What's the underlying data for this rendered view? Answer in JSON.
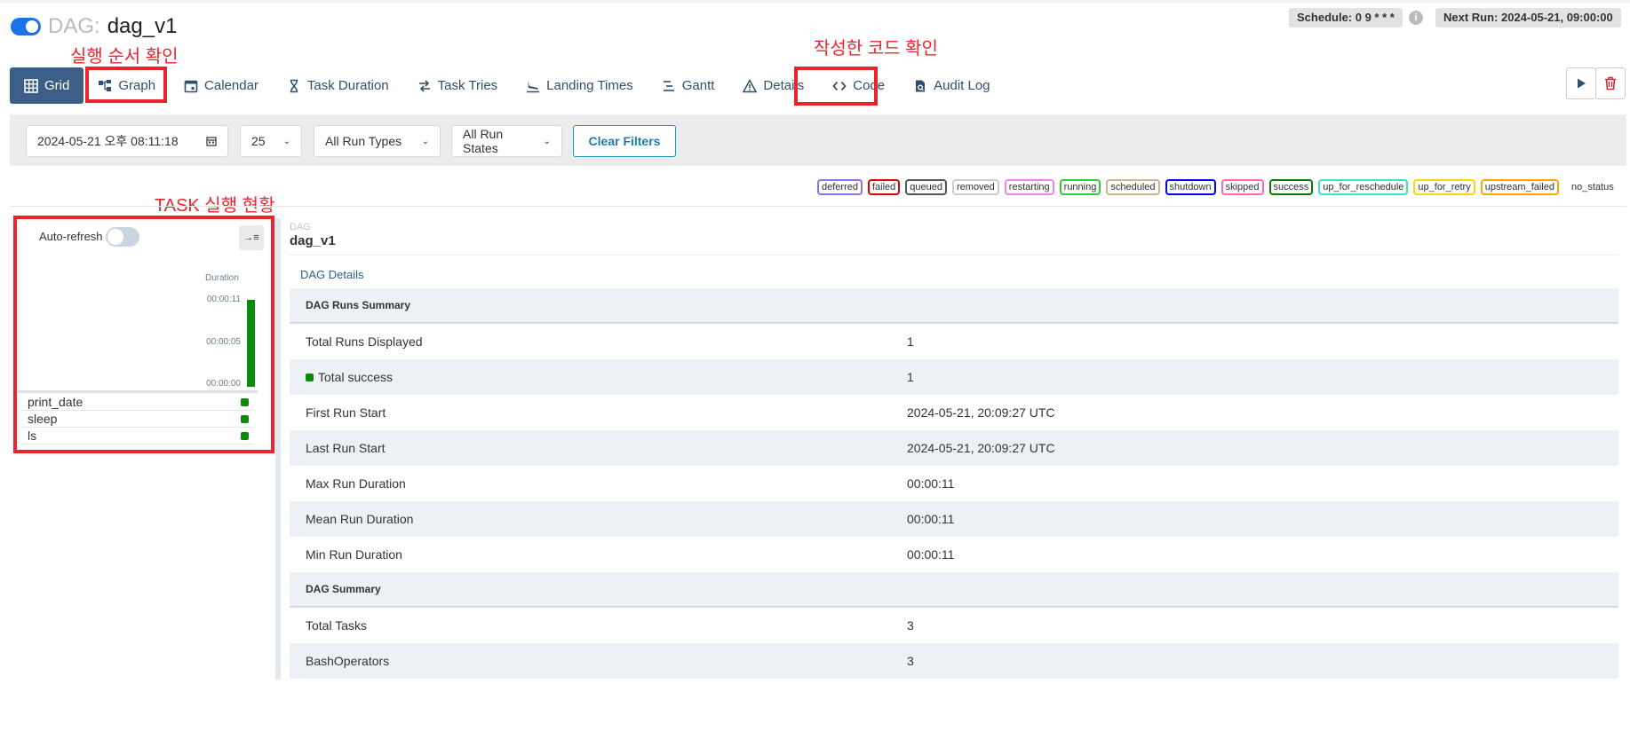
{
  "header": {
    "dag_label": "DAG:",
    "dag_id": "dag_v1",
    "schedule": "Schedule: 0 9 * * *",
    "next_run": "Next Run: 2024-05-21, 09:00:00",
    "info_glyph": "i"
  },
  "annotations": {
    "graph_note": "실행 순서 확인",
    "code_note": "작성한 코드 확인",
    "task_note": "TASK 실행 현황"
  },
  "tabs": [
    {
      "label": "Grid",
      "icon": "grid-icon"
    },
    {
      "label": "Graph",
      "icon": "graph-icon"
    },
    {
      "label": "Calendar",
      "icon": "calendar-icon"
    },
    {
      "label": "Task Duration",
      "icon": "hourglass-icon"
    },
    {
      "label": "Task Tries",
      "icon": "retry-icon"
    },
    {
      "label": "Landing Times",
      "icon": "landing-icon"
    },
    {
      "label": "Gantt",
      "icon": "gantt-icon"
    },
    {
      "label": "Details",
      "icon": "warning-icon"
    },
    {
      "label": "Code",
      "icon": "code-icon"
    },
    {
      "label": "Audit Log",
      "icon": "audit-icon"
    }
  ],
  "filters": {
    "date": "2024-05-21 오후 08:11:18",
    "num_runs": "25",
    "run_type": "All Run Types",
    "run_state": "All Run States",
    "clear_label": "Clear Filters"
  },
  "legend": [
    {
      "label": "deferred",
      "color": "#9370db"
    },
    {
      "label": "failed",
      "color": "#e00000"
    },
    {
      "label": "queued",
      "color": "#555555"
    },
    {
      "label": "removed",
      "color": "#cccccc"
    },
    {
      "label": "restarting",
      "color": "#ee82ee"
    },
    {
      "label": "running",
      "color": "#32cd32"
    },
    {
      "label": "scheduled",
      "color": "#d2b48c"
    },
    {
      "label": "shutdown",
      "color": "#0000ff"
    },
    {
      "label": "skipped",
      "color": "#ff69b4"
    },
    {
      "label": "success",
      "color": "#008000"
    },
    {
      "label": "up_for_reschedule",
      "color": "#40e0d0"
    },
    {
      "label": "up_for_retry",
      "color": "#ffd700"
    },
    {
      "label": "upstream_failed",
      "color": "#ffa500"
    }
  ],
  "legend_plain": "no_status",
  "grid": {
    "auto_refresh": "Auto-refresh",
    "collapse_glyph": "→≡",
    "duration_label": "Duration",
    "ticks": [
      "00:00:11",
      "00:00:05",
      "00:00:00"
    ],
    "run_duration": "00:00:11",
    "tasks": [
      "print_date",
      "sleep",
      "ls"
    ]
  },
  "details": {
    "crumb_small": "DAG",
    "crumb_big": "dag_v1",
    "link": "DAG Details",
    "rows": [
      {
        "type": "hdr",
        "c1": "DAG Runs Summary",
        "c2": ""
      },
      {
        "type": "row",
        "c1": "Total Runs Displayed",
        "c2": "1"
      },
      {
        "type": "success",
        "c1": "Total success",
        "c2": "1"
      },
      {
        "type": "row",
        "c1": "First Run Start",
        "c2": "2024-05-21, 20:09:27 UTC"
      },
      {
        "type": "row",
        "c1": "Last Run Start",
        "c2": "2024-05-21, 20:09:27 UTC"
      },
      {
        "type": "row",
        "c1": "Max Run Duration",
        "c2": "00:00:11"
      },
      {
        "type": "row",
        "c1": "Mean Run Duration",
        "c2": "00:00:11"
      },
      {
        "type": "row",
        "c1": "Min Run Duration",
        "c2": "00:00:11"
      },
      {
        "type": "hdr",
        "c1": "DAG Summary",
        "c2": ""
      },
      {
        "type": "row",
        "c1": "Total Tasks",
        "c2": "3"
      },
      {
        "type": "row",
        "c1": "BashOperators",
        "c2": "3"
      }
    ]
  },
  "colors": {
    "accent": "#3b5f86",
    "annotation_red": "#e8252e",
    "success_green": "#0c8a0c"
  }
}
